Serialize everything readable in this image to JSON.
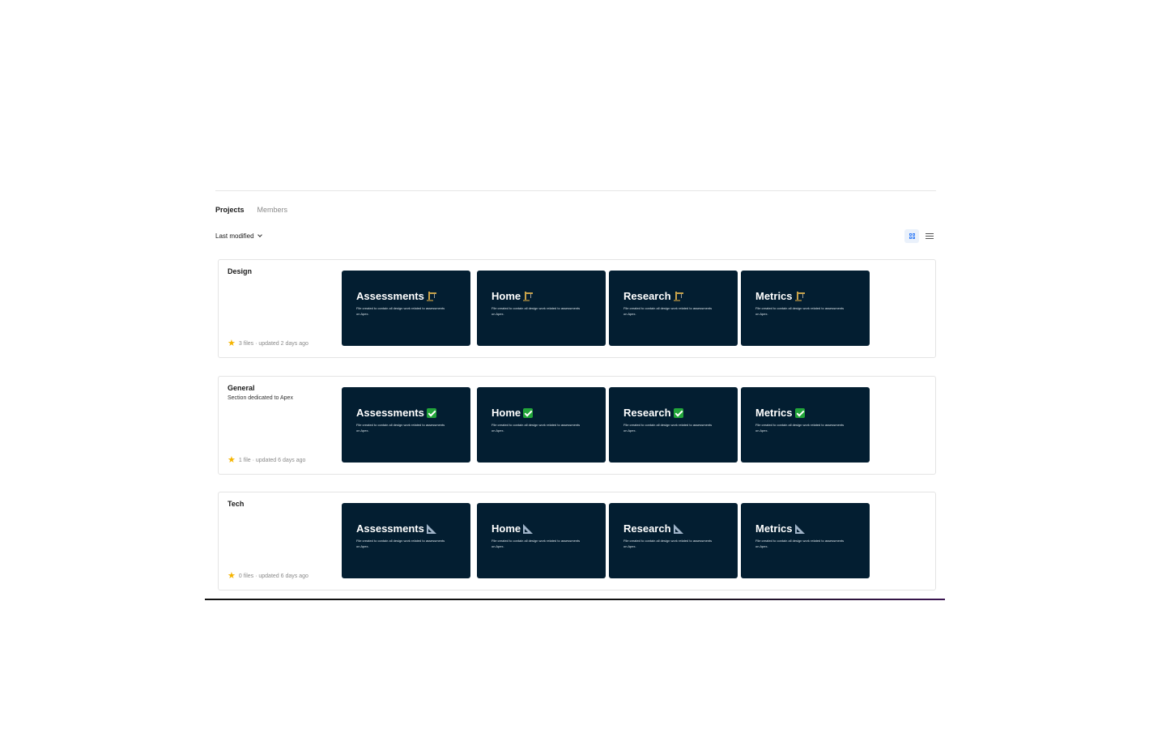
{
  "tabs": [
    {
      "label": "Projects",
      "active": true
    },
    {
      "label": "Members",
      "active": false
    }
  ],
  "sort": {
    "label": "Last modified"
  },
  "view_toggle": {
    "active": "grid"
  },
  "card_description": "File created to contain all design work related to assessments on Apex.",
  "colors": {
    "card_bg": "#031e31",
    "star": "#f5b400",
    "accent": "#3b82f6"
  },
  "sections": [
    {
      "title": "Design",
      "description": "",
      "meta": "3 files · updated 2 days ago",
      "icon": "crane-icon",
      "cards": [
        {
          "title": "Assessments"
        },
        {
          "title": "Home"
        },
        {
          "title": "Research"
        },
        {
          "title": "Metrics"
        }
      ]
    },
    {
      "title": "General",
      "description": "Section dedicated to Apex",
      "meta": "1 file · updated 6 days ago",
      "icon": "check-icon",
      "cards": [
        {
          "title": "Assessments"
        },
        {
          "title": "Home"
        },
        {
          "title": "Research"
        },
        {
          "title": "Metrics"
        }
      ]
    },
    {
      "title": "Tech",
      "description": "",
      "meta": "0 files · updated 6 days ago",
      "icon": "triangle-ruler-icon",
      "cards": [
        {
          "title": "Assessments"
        },
        {
          "title": "Home"
        },
        {
          "title": "Research"
        },
        {
          "title": "Metrics"
        }
      ]
    }
  ]
}
